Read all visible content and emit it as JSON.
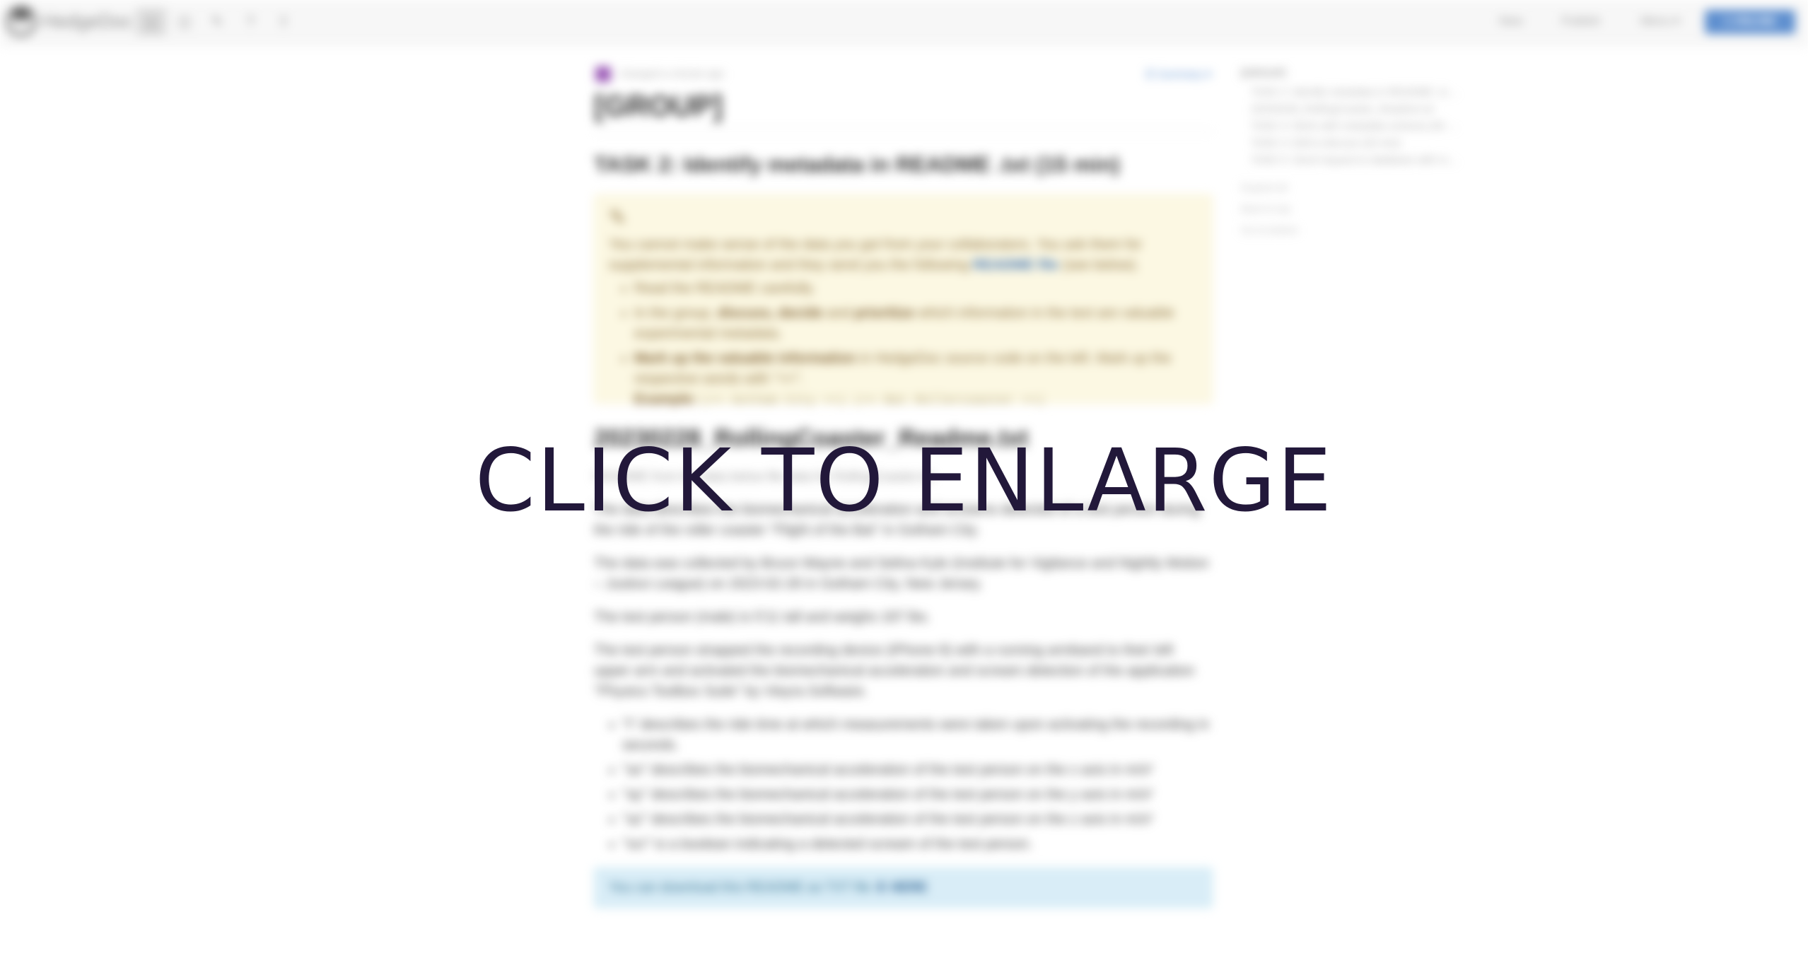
{
  "navbar": {
    "brand": "HedgeDoc",
    "nav_items": [
      "New",
      "Publish",
      "Menu ▾"
    ],
    "online_button": "1 ONLINE"
  },
  "doc": {
    "changed_text": "changed a minute ago",
    "summary_link": "☰ Summary ▾",
    "group_title": "[GROUP]",
    "task_title": "TASK 2: Identify metadata in README .txt (15 min)",
    "alert": {
      "intro_1": "You cannot make sense of the data you got from your collaborators. You ask them for supplemental information and they send you the following ",
      "intro_link": "README file",
      "intro_2": " (see below).",
      "bullet1": "Read the README carefully.",
      "bullet2_pre": "In the group, ",
      "bullet2_b1": "discuss, decide",
      "bullet2_mid": " and ",
      "bullet2_b2": "prioritize",
      "bullet2_post": " which information in the text are valuable experimental metadata.",
      "bullet3_b": "Mark up the valuable information",
      "bullet3_post": " in HedgeDoc source code on the left. Mark up the respective words with \"==\".",
      "example_label": "Example:",
      "example_code": "(== Gotham City ==) (== Bat Rollercoaster ==)"
    },
    "file_title": "20230228_RollingCoaster_Readme.txt",
    "file_para": "README from the data below file data for RollingCoaster.txt",
    "para1": "The data describes the biomechanical acceleration and screams detected of a test person during the ride of the roller coaster \"Flight of the Bat\" in Gotham City.",
    "para2": "The data was collected by Bruce Wayne and Selina Kyle (Institute for Vigilance and Nightly Motion – Justice League) on 2023-02-28 in Gotham City, New Jersey.",
    "para3": "The test person (male) is 5'11 tall and weighs 187 lbs.",
    "para4": "The test person strapped the recording device (iPhone 8) with a running armband to their left upper arm and activated the biomechanical acceleration and scream detection of the application \"Physics Toolbox Suite\" by Vieyra Software.",
    "vars": [
      "\"t\" describes the ride time at which measurements were taken upon activating the recording in seconds.",
      "\"ax\" describes the biomechanical acceleration of the test person on the x axis in m/s²",
      "\"ay\" describes the biomechanical acceleration of the test person on the y axis in m/s²",
      "\"az\" describes the biomechanical acceleration of the test person on the z axis in m/s²",
      "\"scr\" is a boolean indicating a detected scream of the test person."
    ],
    "download_text": "You can download this README as TXT file ",
    "download_link": "⬇ HERE"
  },
  "toc": {
    "head": "[GROUP]",
    "items": [
      "TASK 2: Identify metadata in README .txt (15 min)",
      "20230228_RollingCoaster_Readme.txt",
      "TASK 3: Work with metadata schema (30 min)",
      "TASK 4: Edit & discuss (20 min)",
      "TASK 5: Send request to database with metadata (15 min)"
    ],
    "actions": [
      "Expand all",
      "Back to top",
      "Go to bottom"
    ]
  },
  "overlay": {
    "text": "CLICK TO ENLARGE"
  }
}
